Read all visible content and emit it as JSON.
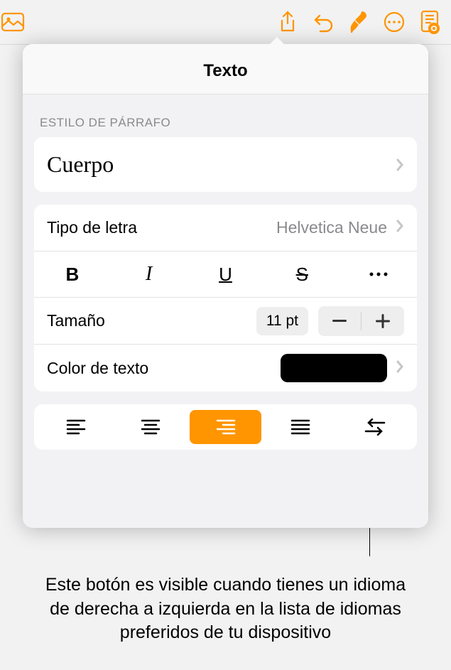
{
  "toolbar": {
    "icons": [
      "media",
      "share",
      "undo",
      "format",
      "more",
      "read-mode"
    ]
  },
  "popover": {
    "title": "Texto",
    "paragraph_style_label": "ESTILO DE PÁRRAFO",
    "paragraph_style_value": "Cuerpo",
    "font_label": "Tipo de letra",
    "font_value": "Helvetica Neue",
    "format_buttons": {
      "bold": "B",
      "italic": "I",
      "underline": "U",
      "strike": "S"
    },
    "size_label": "Tamaño",
    "size_value": "11 pt",
    "color_label": "Color de texto",
    "color_value": "#000000",
    "alignment_selected": 2
  },
  "callout": {
    "text": "Este botón es visible cuando tienes un idioma de derecha a izquierda en la lista de idiomas preferidos de tu dispositivo"
  }
}
